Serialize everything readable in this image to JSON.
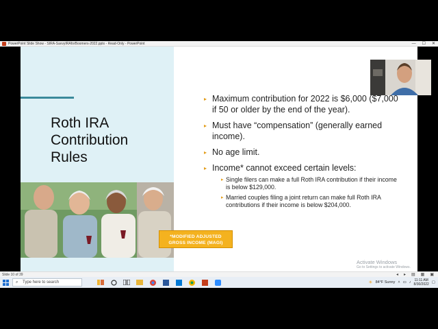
{
  "window": {
    "title": "PowerPoint Slide Show  -  SIRA-SavvyIRAforBoomers-2022.pptx  -  Read-Only  -  PowerPoint",
    "controls": [
      "—",
      "☐",
      "✕"
    ]
  },
  "slide": {
    "title_lines": [
      "Roth IRA",
      "Contribution",
      "Rules"
    ],
    "bullets": [
      "Maximum contribution for 2022 is $6,000 ($7,000 if 50 or older by the end of the year).",
      "Must have “compensation” (generally earned income).",
      "No age limit.",
      "Income* cannot exceed certain levels:"
    ],
    "sub_bullets": [
      "Single filers can make a full Roth IRA contribution if their income is below $129,000.",
      "Married couples filing a joint return can make full Roth IRA contributions if their income is below $204,000."
    ],
    "magi_note_lines": [
      "*MODIFIED ADJUSTED",
      "GROSS INCOME (MAGI)"
    ],
    "activate_windows": {
      "line1": "Activate Windows",
      "line2": "Go to Settings to activate Windows."
    }
  },
  "statusbar": {
    "slide_count": "Slide 10 of 39",
    "controls": [
      "◂",
      "▸",
      "▤",
      "▦",
      "▣"
    ]
  },
  "taskbar": {
    "search_placeholder": "Type here to search",
    "weather": "84°F  Sunny",
    "time": "11:11 AM",
    "date": "8/30/2022"
  },
  "colors": {
    "accent": "#e39d1a",
    "panel": "#dff1f6",
    "teal_line": "#3a8a9b",
    "magi_box": "#f4b21f"
  }
}
